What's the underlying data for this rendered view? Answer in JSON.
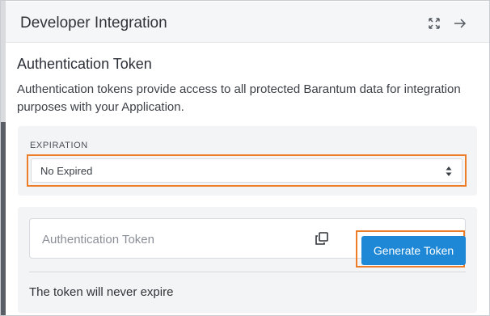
{
  "header": {
    "title": "Developer Integration",
    "icons": [
      "expand-icon",
      "arrow-right-icon"
    ]
  },
  "section": {
    "title": "Authentication Token",
    "description": "Authentication tokens provide access to all protected Barantum data for integration purposes with your Application."
  },
  "expiration": {
    "label": "EXPIRATION",
    "selected": "No Expired"
  },
  "token": {
    "placeholder": "Authentication Token",
    "generate_label": "Generate Token",
    "note": "The token will never expire"
  },
  "colors": {
    "accent": "#1e88d6",
    "highlight": "#ee7d2a"
  }
}
